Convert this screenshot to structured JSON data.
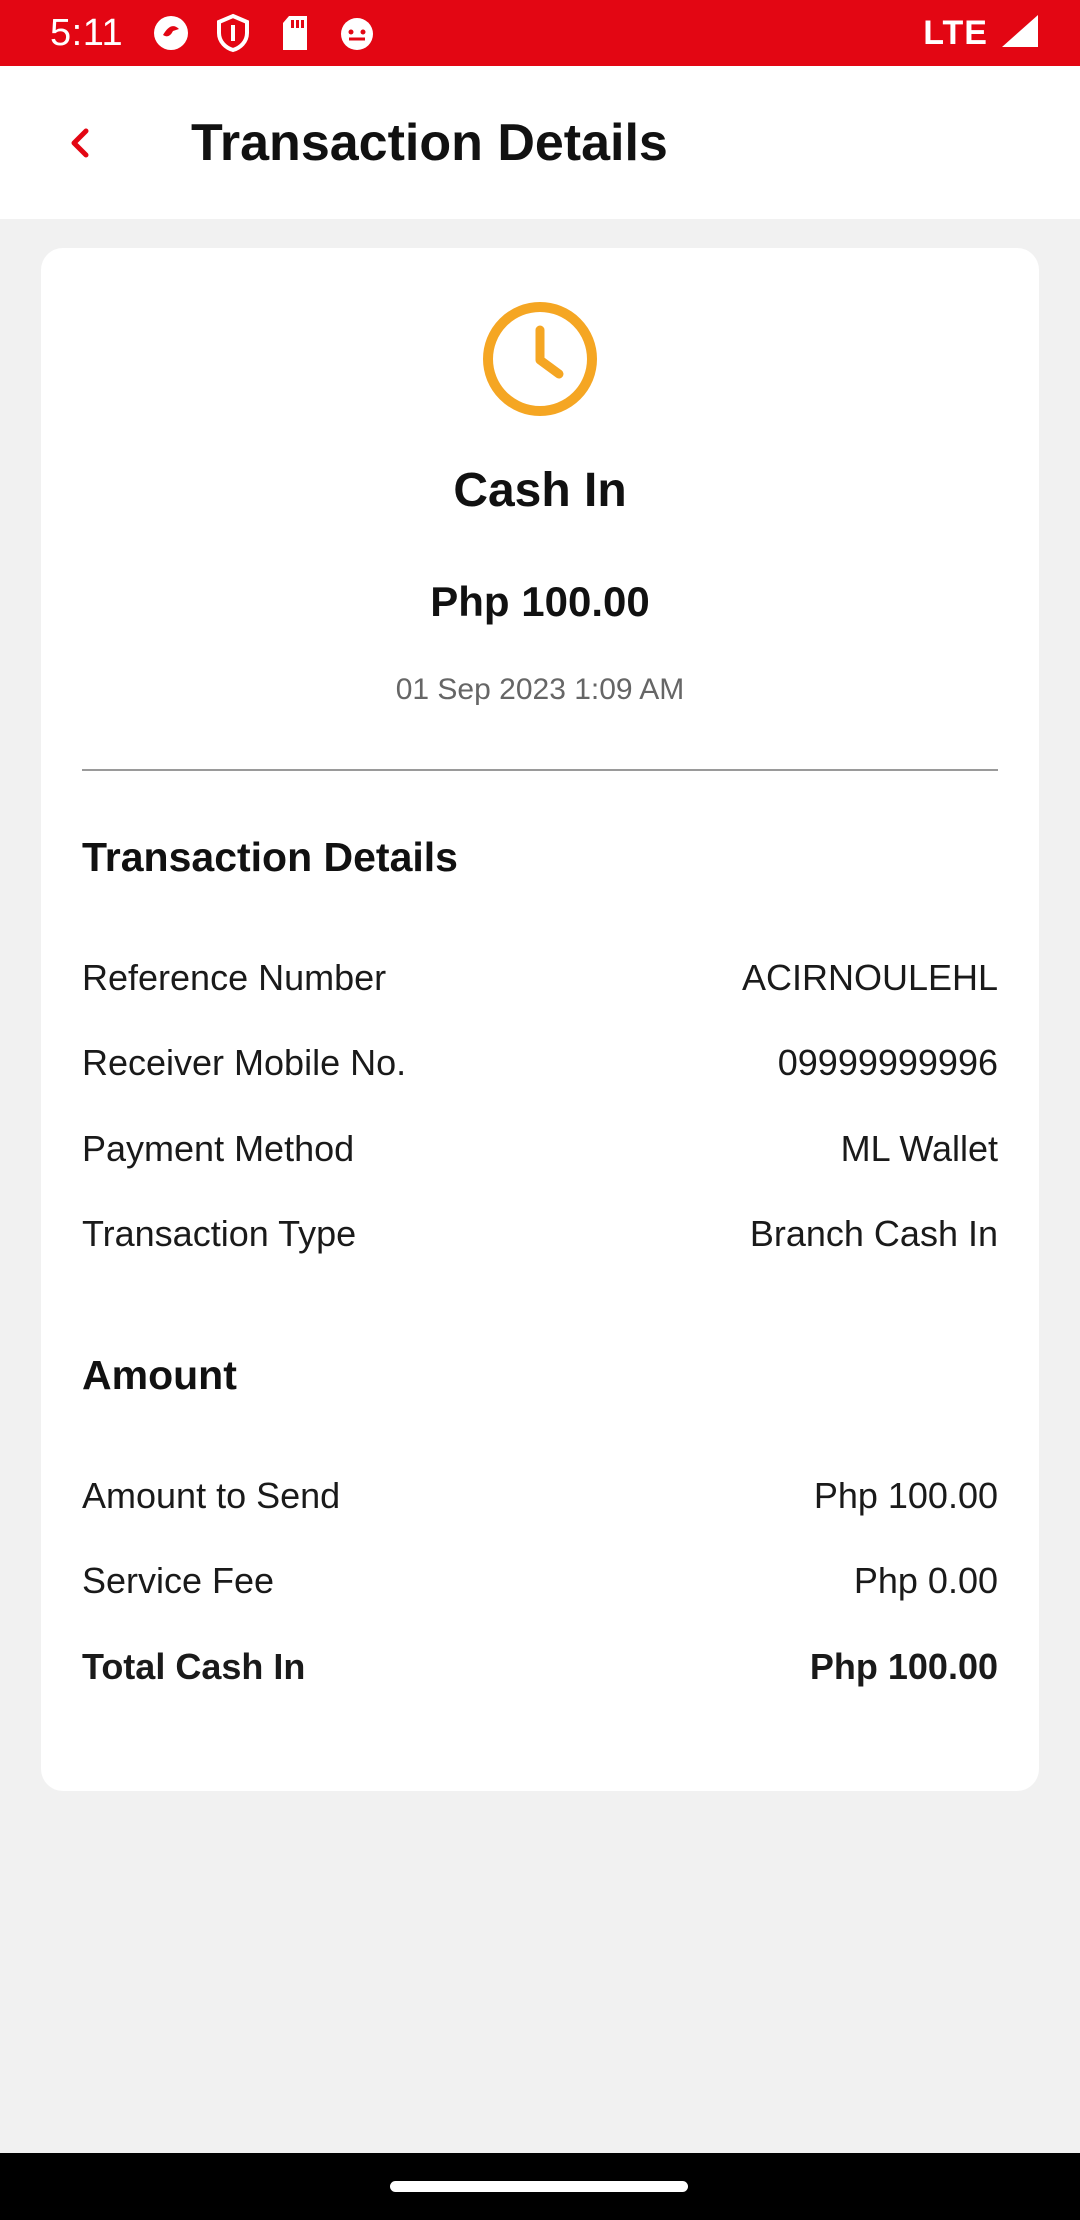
{
  "status_bar": {
    "time": "5:11",
    "network": "LTE",
    "icons": [
      "app-notification-icon",
      "shield-icon",
      "sd-card-icon",
      "face-icon",
      "signal-icon"
    ]
  },
  "header": {
    "title": "Transaction Details",
    "back_icon": "chevron-left-icon"
  },
  "summary": {
    "status_icon": "clock-icon",
    "title": "Cash In",
    "amount": "Php 100.00",
    "datetime": "01 Sep 2023 1:09 AM"
  },
  "details": {
    "section_title": "Transaction Details",
    "rows": [
      {
        "label": "Reference Number",
        "value": "ACIRNOULEHL"
      },
      {
        "label": "Receiver Mobile No.",
        "value": "09999999996"
      },
      {
        "label": "Payment Method",
        "value": "ML Wallet"
      },
      {
        "label": "Transaction Type",
        "value": "Branch Cash In"
      }
    ]
  },
  "amount": {
    "section_title": "Amount",
    "rows": [
      {
        "label": "Amount to Send",
        "value": "Php 100.00"
      },
      {
        "label": "Service Fee",
        "value": "Php 0.00"
      },
      {
        "label": "Total Cash In",
        "value": "Php 100.00"
      }
    ]
  },
  "colors": {
    "brand_red": "#e30613",
    "pending_orange": "#f5a623",
    "background": "#f1f1f1"
  }
}
